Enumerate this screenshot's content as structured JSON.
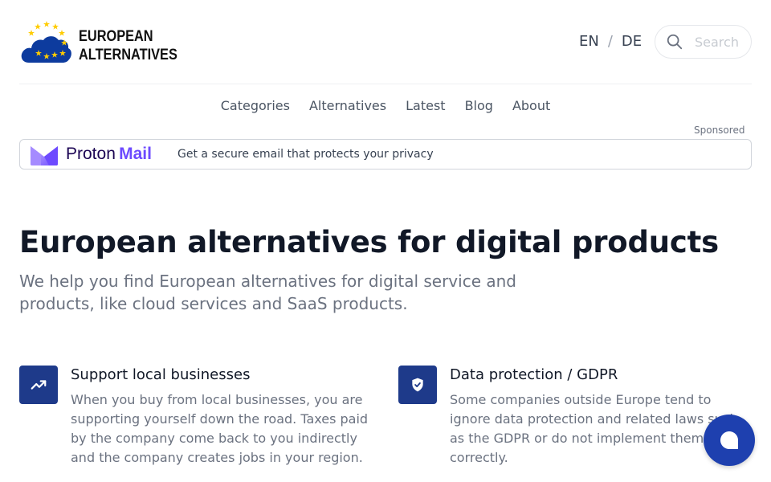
{
  "header": {
    "logo_line1": "EUROPEAN",
    "logo_line2": "ALTERNATIVES",
    "lang_en": "EN",
    "lang_sep": "/",
    "lang_de": "DE",
    "search_placeholder": "Search"
  },
  "nav": {
    "items": [
      {
        "label": "Categories"
      },
      {
        "label": "Alternatives"
      },
      {
        "label": "Latest"
      },
      {
        "label": "Blog"
      },
      {
        "label": "About"
      }
    ]
  },
  "ad": {
    "sponsored_label": "Sponsored",
    "brand_part1": "Proton",
    "brand_part2": "Mail",
    "text": "Get a secure email that protects your privacy"
  },
  "hero": {
    "title": "European alternatives for digital products",
    "subtitle": "We help you find European alternatives for digital service and products, like cloud services and SaaS products."
  },
  "features": [
    {
      "icon": "trending-up-icon",
      "title": "Support local businesses",
      "description": "When you buy from local businesses, you are supporting yourself down the road. Taxes paid by the company come back to you indirectly and the company creates jobs in your region."
    },
    {
      "icon": "shield-check-icon",
      "title": "Data protection / GDPR",
      "description": "Some companies outside Europe tend to ignore data protection and related laws such as the GDPR or do not implement them correctly."
    }
  ],
  "colors": {
    "brand_blue": "#1e3a8a",
    "chat_blue": "#1e40af",
    "proton_purple": "#6d4aff",
    "eu_yellow": "#ffcc00"
  }
}
